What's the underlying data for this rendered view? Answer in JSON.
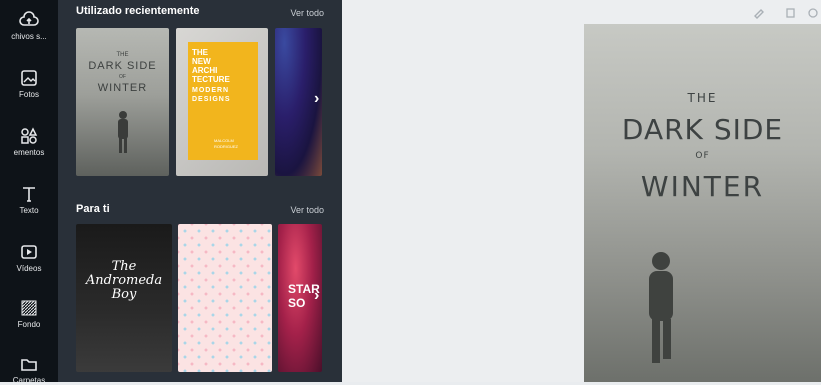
{
  "rail": {
    "items": [
      {
        "label": "chivos s...",
        "icon": "cloud-upload-icon"
      },
      {
        "label": "Fotos",
        "icon": "photo-icon"
      },
      {
        "label": "ementos",
        "icon": "shapes-icon"
      },
      {
        "label": "Texto",
        "icon": "text-icon"
      },
      {
        "label": "Vídeos",
        "icon": "video-icon"
      },
      {
        "label": "Fondo",
        "icon": "background-icon"
      },
      {
        "label": "Carpetas",
        "icon": "folder-icon"
      }
    ]
  },
  "panel": {
    "recent": {
      "title": "Utilizado recientemente",
      "see_all": "Ver todo",
      "thumb1": {
        "line1": "THE",
        "line2": "DARK SIDE",
        "line3": "OF",
        "line4": "WINTER"
      },
      "thumb2": {
        "line1": "THE",
        "line2": "NEW",
        "line3": "ARCHI",
        "line4": "TECTURE",
        "line5": "MODERN",
        "line6": "DESIGNS",
        "author1": "MALCOLM",
        "author2": "RODRIGUEZ"
      }
    },
    "for_you": {
      "title": "Para ti",
      "see_all": "Ver todo",
      "thumb1": {
        "line1": "The",
        "line2": "Andromeda",
        "line3": "Boy"
      },
      "thumb3": {
        "line1": "STAR",
        "line2": "SO"
      }
    },
    "accent_yellow": "#f2b51d"
  },
  "canvas": {
    "cover": {
      "line1": "THE",
      "line2": "DARK SIDE",
      "line3": "OF",
      "line4": "WINTER"
    }
  }
}
